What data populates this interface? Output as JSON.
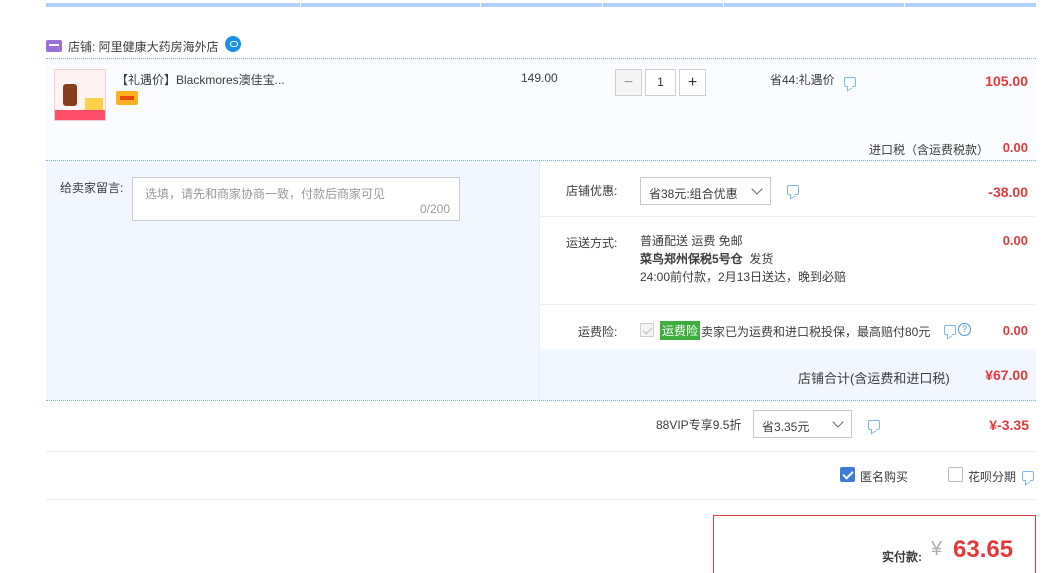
{
  "shop": {
    "label": "店铺: 阿里健康大药房海外店"
  },
  "item": {
    "title": "【礼遇价】Blackmores澳佳宝...",
    "unit_price": "149.00",
    "quantity": "1",
    "quantity_minus": "−",
    "quantity_plus": "+",
    "saving": "省44:礼遇价",
    "subtotal": "105.00",
    "import_tax_label": "进口税（含运费税款）",
    "import_tax_value": "0.00"
  },
  "message": {
    "label": "给卖家留言:",
    "placeholder": "选填，请先和商家协商一致，付款后商家可见",
    "count": "0/200"
  },
  "shop_discount": {
    "label": "店铺优惠:",
    "selected": "省38元:组合优惠",
    "value": "-38.00"
  },
  "shipping": {
    "label": "运送方式:",
    "line1": "普通配送 运费 免邮",
    "line2_bold": "菜鸟郑州保税5号仓",
    "line2_rest": "发货",
    "line3": "24:00前付款，2月13日送达，晚到必赔",
    "value": "0.00"
  },
  "insurance": {
    "label": "运费险:",
    "tag": "运费险",
    "text": "卖家已为运费和进口税投保，最高赔付80元",
    "help": "?",
    "value": "0.00"
  },
  "shop_total": {
    "label": "店铺合计(含运费和进口税)",
    "value": "¥67.00"
  },
  "vip": {
    "label": "88VIP专享9.5折",
    "selected": "省3.35元",
    "value": "¥-3.35"
  },
  "options": {
    "anonymous": "匿名购买",
    "huabei": "花呗分期"
  },
  "payment": {
    "label": "实付款:",
    "currency": "¥",
    "amount": "63.65"
  },
  "colors": {
    "accent_red": "#e4393c",
    "link_blue": "#3e7bd9",
    "insurance_green": "#3fae3f",
    "panel_blue": "#f2f7ff"
  }
}
